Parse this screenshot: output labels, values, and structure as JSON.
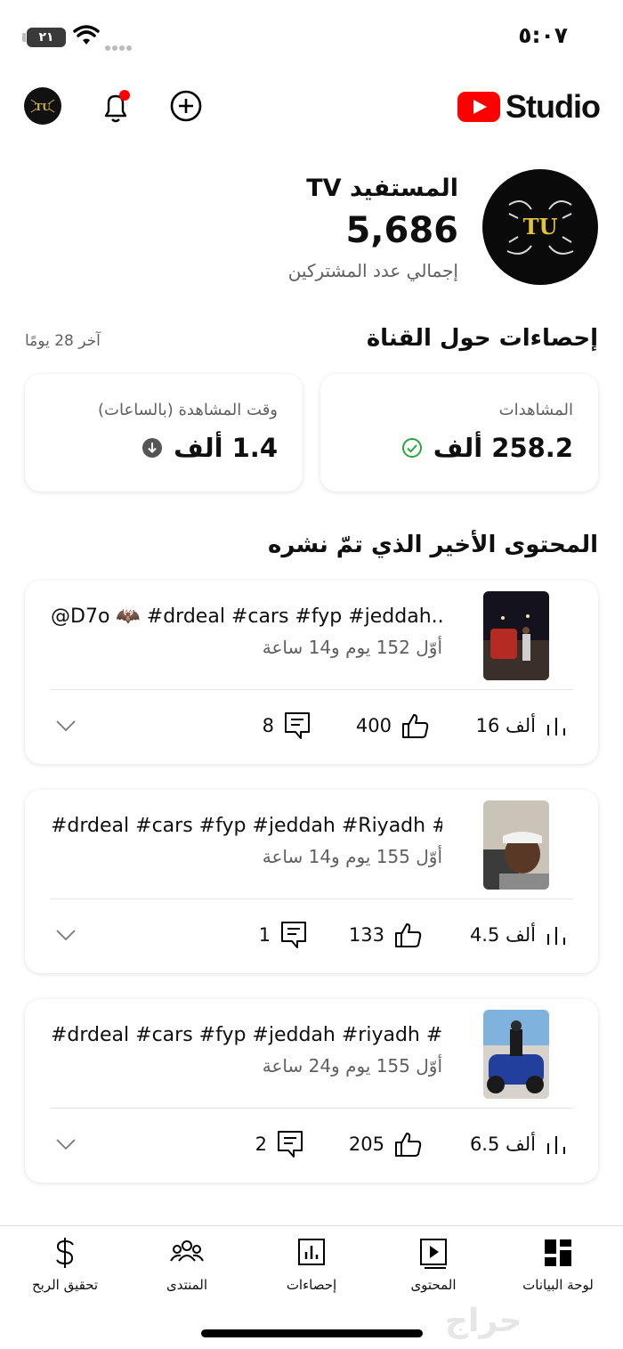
{
  "status_bar": {
    "time": "٥:٠٧",
    "battery": "٢١"
  },
  "header": {
    "logo_text": "Studio",
    "notification_badge_color": "#ff0000"
  },
  "channel": {
    "name": "المستفيد TV",
    "subscriber_count": "5,686",
    "subscriber_label": "إجمالي عدد المشتركين",
    "avatar_text": "TU"
  },
  "analytics": {
    "title": "إحصاءات حول القناة",
    "period": "آخر 28 يومًا",
    "cards": [
      {
        "label": "المشاهدات",
        "value": "258.2 ألف",
        "status_icon": "check-circle-icon"
      },
      {
        "label": "وقت المشاهدة (بالساعات)",
        "value": "1.4 ألف",
        "status_icon": "arrow-down-circle-icon"
      }
    ]
  },
  "recent_content": {
    "title": "المحتوى الأخير الذي تمّ نشره",
    "videos": [
      {
        "title": "@D7o 🦇 #drdeal #cars #fyp #jeddah...",
        "age": "أوّل 152 يوم و14 ساعة",
        "views": "16 ألف",
        "likes": "400",
        "comments": "8"
      },
      {
        "title": "#drdeal #cars #fyp #jeddah #Riyadh #...",
        "age": "أوّل 155 يوم و14 ساعة",
        "views": "4.5 ألف",
        "likes": "133",
        "comments": "1"
      },
      {
        "title": "#drdeal #cars #fyp #jeddah #riyadh #...",
        "age": "أوّل 155 يوم و24 ساعة",
        "views": "6.5 ألف",
        "likes": "205",
        "comments": "2"
      }
    ]
  },
  "bottom_nav": [
    {
      "label": "لوحة البيانات",
      "icon": "dashboard-icon"
    },
    {
      "label": "المحتوى",
      "icon": "content-icon"
    },
    {
      "label": "إحصاءات",
      "icon": "analytics-icon"
    },
    {
      "label": "المنتدى",
      "icon": "community-icon"
    },
    {
      "label": "تحقيق الربح",
      "icon": "dollar-icon"
    }
  ],
  "watermark": "حراج"
}
